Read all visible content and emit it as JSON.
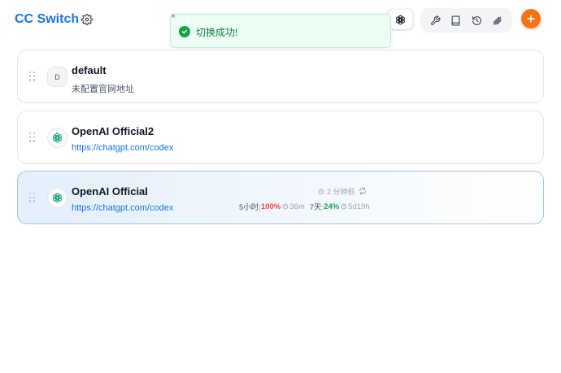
{
  "header": {
    "title": "CC Switch",
    "icons": {
      "settings": "gear-icon",
      "app": "openai-icon",
      "tools": [
        "wrench-icon",
        "book-icon",
        "history-icon",
        "antenna-icon"
      ],
      "add": "plus-icon"
    }
  },
  "toast": {
    "message": "切换成功!",
    "close": "×"
  },
  "providers": [
    {
      "name": "default",
      "avatar_letter": "D",
      "subtitle": "未配置官网地址",
      "icon": "letter-avatar",
      "active": false
    },
    {
      "name": "OpenAI Official2",
      "subtitle": "https://chatgpt.com/codex",
      "icon": "openai-icon",
      "active": false
    },
    {
      "name": "OpenAI Official",
      "subtitle": "https://chatgpt.com/codex",
      "icon": "openai-icon",
      "active": true,
      "usage": {
        "updated": "2 分钟前",
        "five_hour_label": "5小时:",
        "five_hour_pct": "100%",
        "five_hour_reset": "36m",
        "seven_day_label": "7天:",
        "seven_day_pct": "24%",
        "seven_day_reset": "5d19h"
      }
    }
  ],
  "colors": {
    "brand": "#1a73e8",
    "accent": "#f97316",
    "success": "#16a34a",
    "danger": "#ef4444"
  }
}
